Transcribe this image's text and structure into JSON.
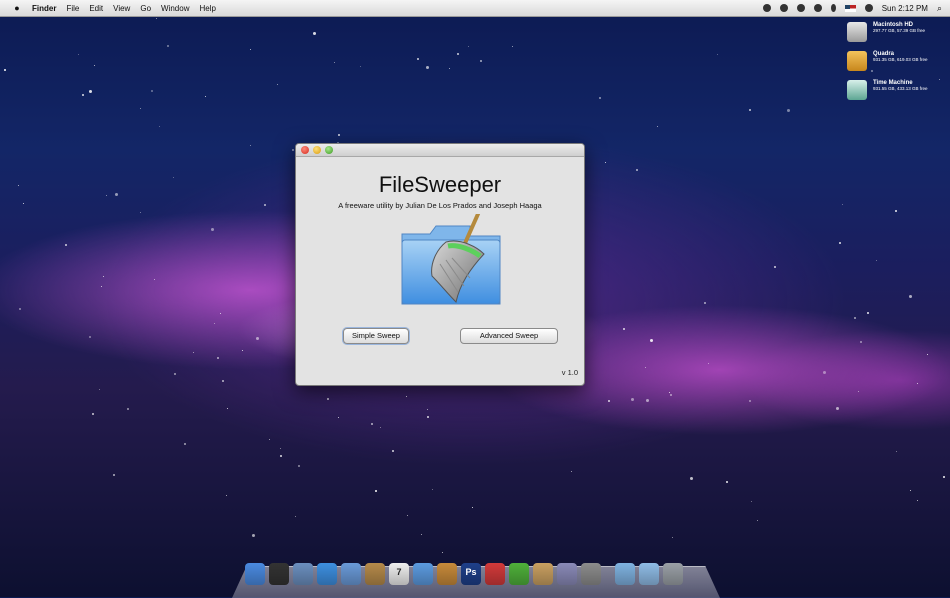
{
  "menubar": {
    "apple": "",
    "items": [
      "Finder",
      "File",
      "Edit",
      "View",
      "Go",
      "Window",
      "Help"
    ],
    "clock": "Sun 2:12 PM"
  },
  "desktop": {
    "drives": [
      {
        "name": "Macintosh HD",
        "info": "297.77 GB, 57.39 GB free",
        "color": "#c8c8c8"
      },
      {
        "name": "Quadra",
        "info": "931.35 GB, 619.03 GB free",
        "color": "#e3a83a"
      },
      {
        "name": "Time Machine",
        "info": "931.55 GB, 433.13 GB free",
        "color": "#6fb8a4"
      }
    ]
  },
  "window": {
    "title": "FileSweeper",
    "subtitle": "A freeware utility by Julian De Los Prados and Joseph Haaga",
    "simple_button": "Simple Sweep",
    "advanced_button": "Advanced Sweep",
    "version": "v 1.0"
  },
  "dock": {
    "icons": [
      {
        "name": "finder-icon",
        "color": "#4a8ae0"
      },
      {
        "name": "dashboard-icon",
        "color": "#333333"
      },
      {
        "name": "preview-icon",
        "color": "#6b8fbf"
      },
      {
        "name": "safari-icon",
        "color": "#3d8fe0"
      },
      {
        "name": "facetime-icon",
        "color": "#6a9ad8"
      },
      {
        "name": "address-book-icon",
        "color": "#b58a4a"
      },
      {
        "name": "ical-icon",
        "color": "#eeeeee"
      },
      {
        "name": "itunes-icon",
        "color": "#5c9be0"
      },
      {
        "name": "iphoto-icon",
        "color": "#c78a3a"
      },
      {
        "name": "photoshop-icon",
        "color": "#1e3f8a"
      },
      {
        "name": "textedit-icon",
        "color": "#d23a3a"
      },
      {
        "name": "leaf-icon",
        "color": "#4fb03a"
      },
      {
        "name": "coffee-icon",
        "color": "#c9a061"
      },
      {
        "name": "cube-icon",
        "color": "#8a8ab8"
      },
      {
        "name": "system-preferences-icon",
        "color": "#8c8c8c"
      },
      {
        "name": "applications-folder-icon",
        "color": "#7fb2e0"
      },
      {
        "name": "downloads-folder-icon",
        "color": "#8fbce6"
      },
      {
        "name": "trash-icon",
        "color": "#9aa0a6"
      }
    ],
    "ps_label": "Ps",
    "ical_day": "7"
  }
}
